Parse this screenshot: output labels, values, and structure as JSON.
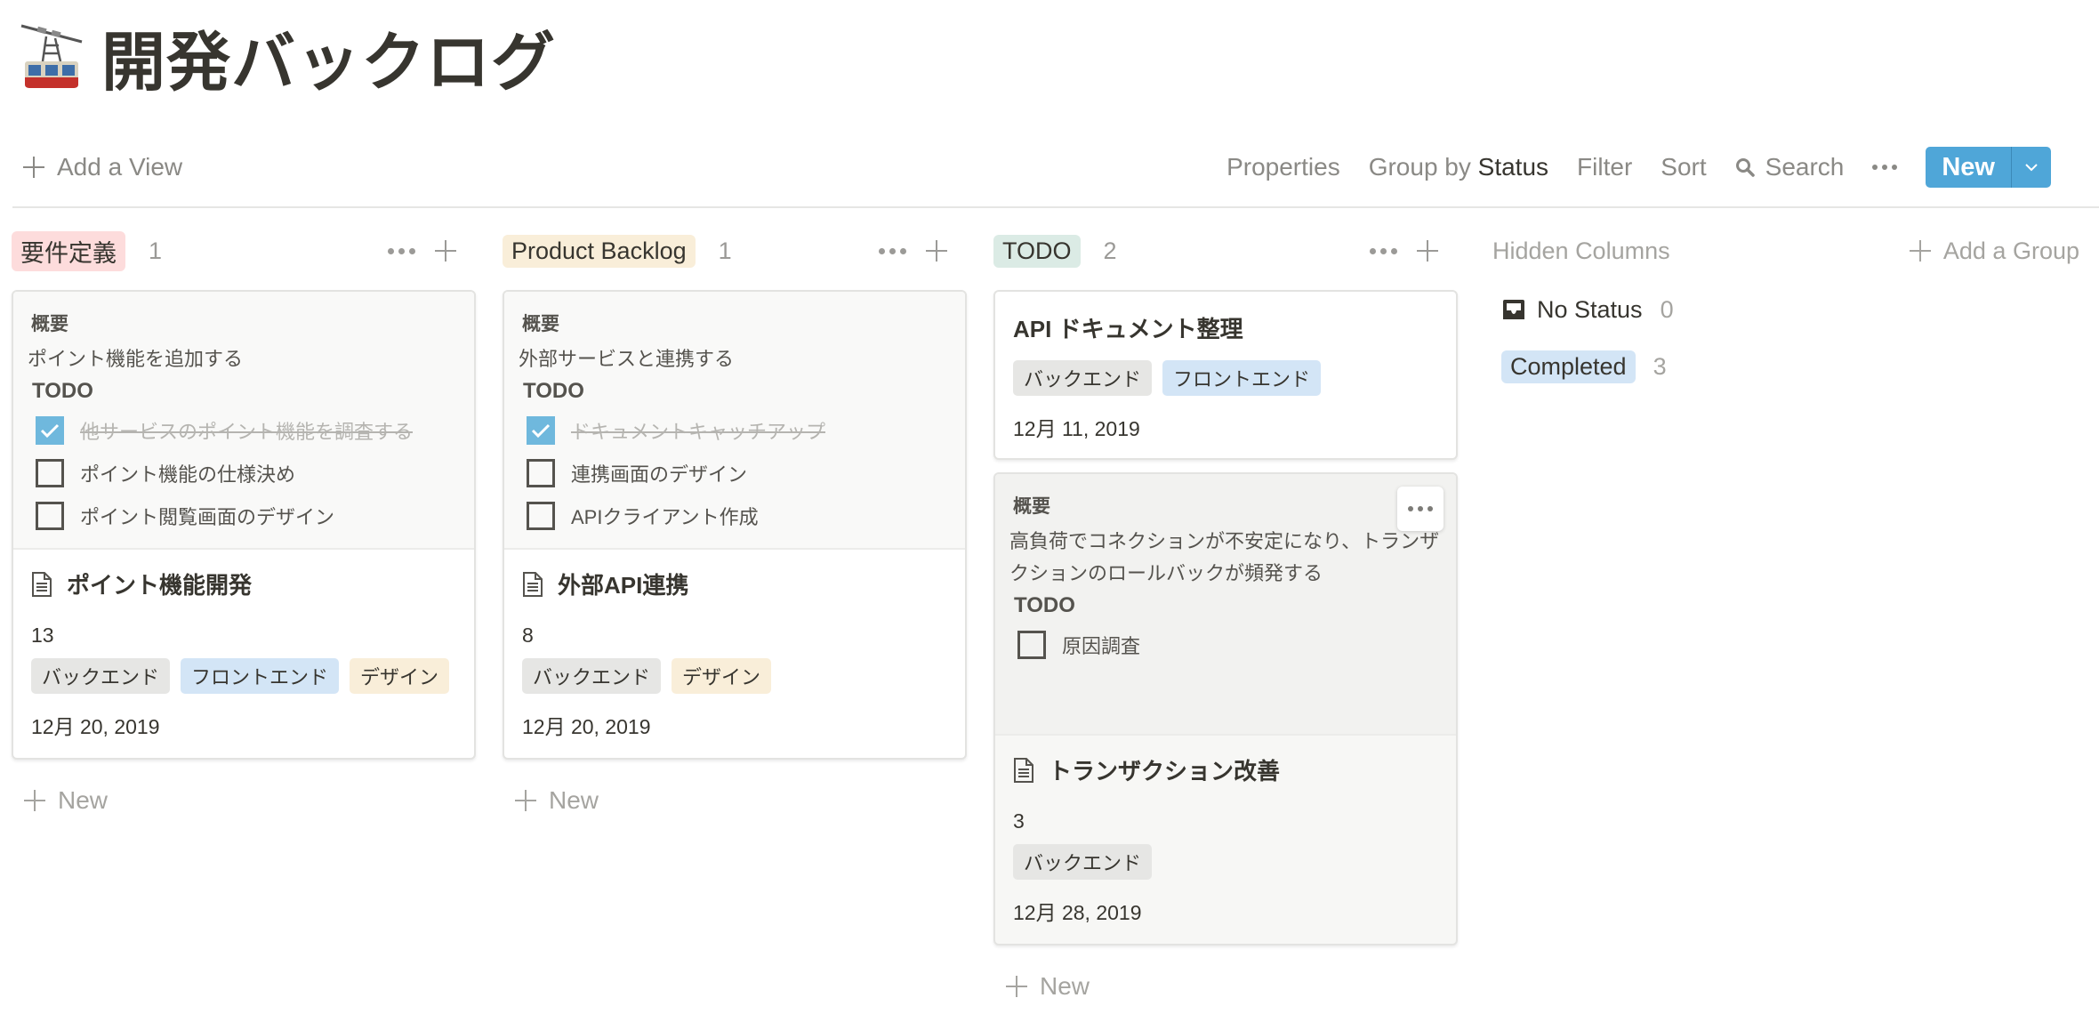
{
  "page": {
    "icon": "aerial-tramway-icon",
    "title": "開発バックログ"
  },
  "toolbar": {
    "add_view": "Add a View",
    "properties": "Properties",
    "group_by_prefix": "Group by",
    "group_by_value": "Status",
    "filter": "Filter",
    "sort": "Sort",
    "search": "Search",
    "new": "New"
  },
  "colors": {
    "accent": "#4fa6d8",
    "checkbox_checked": "#6fb8dd",
    "status_requirements": "#fddcdc",
    "status_backlog": "#f9eed9",
    "status_todo": "#dbebe5",
    "status_completed": "#d3e5f6",
    "tag_gray": "#e6e6e4",
    "tag_blue": "#d3e5f6",
    "tag_yellow": "#f9eed9"
  },
  "columns": [
    {
      "status": "要件定義",
      "count": "1",
      "new_label": "New",
      "cards": [
        {
          "preview": {
            "heading": "概要",
            "text": "ポイント機能を追加する",
            "todo_heading": "TODO",
            "todos": [
              {
                "label": "他サービスのポイント機能を調査する",
                "checked": true
              },
              {
                "label": "ポイント機能の仕様決め",
                "checked": false
              },
              {
                "label": "ポイント閲覧画面のデザイン",
                "checked": false
              }
            ]
          },
          "title": "ポイント機能開発",
          "points": "13",
          "tags": [
            "バックエンド",
            "フロントエンド",
            "デザイン"
          ],
          "date": "12月 20, 2019"
        }
      ]
    },
    {
      "status": "Product Backlog",
      "count": "1",
      "new_label": "New",
      "cards": [
        {
          "preview": {
            "heading": "概要",
            "text": "外部サービスと連携する",
            "todo_heading": "TODO",
            "todos": [
              {
                "label": "ドキュメントキャッチアップ",
                "checked": true
              },
              {
                "label": "連携画面のデザイン",
                "checked": false
              },
              {
                "label": "APIクライアント作成",
                "checked": false
              }
            ]
          },
          "title": "外部API連携",
          "points": "8",
          "tags": [
            "バックエンド",
            "デザイン"
          ],
          "date": "12月 20, 2019"
        }
      ]
    },
    {
      "status": "TODO",
      "count": "2",
      "new_label": "New",
      "cards": [
        {
          "title": "API ドキュメント整理",
          "tags": [
            "バックエンド",
            "フロントエンド"
          ],
          "date": "12月 11, 2019"
        },
        {
          "preview": {
            "heading": "概要",
            "text": "高負荷でコネクションが不安定になり、トランザクションのロールバックが頻発する",
            "todo_heading": "TODO",
            "todos": [
              {
                "label": "原因調査",
                "checked": false
              }
            ]
          },
          "title": "トランザクション改善",
          "points": "3",
          "tags": [
            "バックエンド"
          ],
          "date": "12月 28, 2019"
        }
      ]
    }
  ],
  "hidden": {
    "title": "Hidden Columns",
    "add_group": "Add a Group",
    "groups": [
      {
        "label": "No Status",
        "count": "0",
        "icon": "inbox-icon"
      },
      {
        "label": "Completed",
        "count": "3"
      }
    ]
  }
}
